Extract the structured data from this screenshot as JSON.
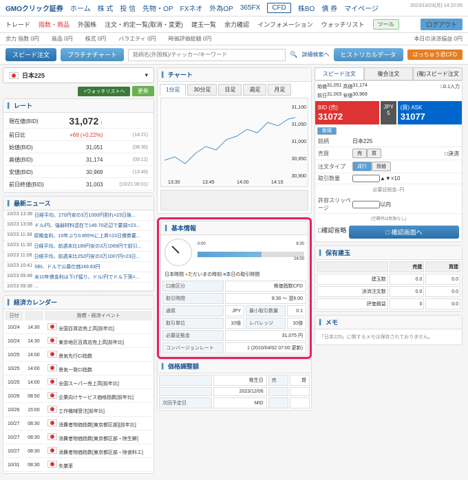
{
  "timestamp": "2023/10/23(月) 14:22:05",
  "topnav": {
    "logo": "GMOクリック証券",
    "items": [
      "ホーム",
      "株 式",
      "投 信",
      "先物・OP",
      "FXネオ",
      "外為OP",
      "365FX",
      "CFD",
      "株BO",
      "債 券",
      "マイページ"
    ],
    "active": "CFD"
  },
  "subnav": {
    "items": [
      "トレード",
      "指数・商品",
      "外国株",
      "注文・約定一覧(取消・変更)",
      "建玉一覧",
      "余力確認",
      "インフォメーション",
      "ウォッチリスト"
    ],
    "tool": "ツール",
    "logout": "ログアウト"
  },
  "status": {
    "items": [
      {
        "l": "余力 指数",
        "v": "0円"
      },
      {
        "l": "商品",
        "v": "0円"
      },
      {
        "l": "株式",
        "v": "0円"
      },
      {
        "l": "バラエティ",
        "v": "0円"
      },
      {
        "l": "時価評価総額",
        "v": "0円"
      },
      {
        "l": "本日の決済損益",
        "v": "0円"
      }
    ]
  },
  "toolbar": {
    "speed": "スピード注文",
    "platinum": "プラチナチャート",
    "placeholder": "銘柄名(外国株)/ティッカー/キーワード",
    "detail": "詳細検索へ",
    "hist": "ヒストリカルデータ",
    "hatchu": "はっちゅう君CFD"
  },
  "symbol": {
    "name": "日本225",
    "watchlist": "+ウォッチリストへ",
    "update": "更新"
  },
  "rate_panel": {
    "title": "レート",
    "rows": [
      {
        "l": "現在値(BID)",
        "v": "31,072",
        "t": "",
        "cls": "big-price",
        "arrow": "↑"
      },
      {
        "l": "前日比",
        "v": "+69 (+0.22%)",
        "t": "(14:21)",
        "red": true
      },
      {
        "l": "始値(BID)",
        "v": "31,051",
        "t": "(08:30)"
      },
      {
        "l": "高値(BID)",
        "v": "31,174",
        "t": "(09:12)"
      },
      {
        "l": "安値(BID)",
        "v": "30,969",
        "t": "(13:40)"
      },
      {
        "l": "前日終値(BID)",
        "v": "31,003",
        "t": "(10/21 06:01)"
      }
    ]
  },
  "news": {
    "title": "最新ニュース",
    "items": [
      {
        "d": "10/23 13:38",
        "t": "日経平均、270円安の3万1000円割れ=23日後..."
      },
      {
        "d": "10/23 13:08",
        "t": "ドル/円、強弱材料混在で149.70近辺で要調=23..."
      },
      {
        "d": "10/23 11:38",
        "t": "原期金利、10年ぶり0.855%に上昇=23日債券要..."
      },
      {
        "d": "10/23 11:30",
        "t": "日経平均、前週末比189円安の3万1069円で前引..."
      },
      {
        "d": "10/23 11:08",
        "t": "日経平均、前週末比252円安の3万1007円=23日..."
      },
      {
        "d": "10/23 10:41",
        "t": "SBI、ドルで公募仕価149.83円"
      },
      {
        "d": "10/23 09:48",
        "t": "米10年債金利は下げ幅り、ドル/円でドル下落=..."
      },
      {
        "d": "10/23 09:38",
        "t": "..."
      }
    ]
  },
  "calendar": {
    "title": "経済カレンダー",
    "h1": "日付",
    "h2": "指標・経済イベント",
    "rows": [
      {
        "d": "10/24",
        "t": "14:30",
        "e": "全国百貨店売上高[前年比]"
      },
      {
        "d": "10/24",
        "t": "14:30",
        "e": "東京地区百貨店売上高[前年比]"
      },
      {
        "d": "10/25",
        "t": "14:00",
        "e": "景気先行CI指数"
      },
      {
        "d": "10/25",
        "t": "14:00",
        "e": "景気一致CI指数"
      },
      {
        "d": "10/25",
        "t": "14:00",
        "e": "全国スーパー売上高[前年比]"
      },
      {
        "d": "10/26",
        "t": "08:50",
        "e": "企業向けサービス価格指数[前年比]"
      },
      {
        "d": "10/26",
        "t": "15:00",
        "e": "工作機械受注[前年比]"
      },
      {
        "d": "10/27",
        "t": "08:30",
        "e": "消費者物価指数[東京都区部][前年比]"
      },
      {
        "d": "10/27",
        "t": "08:30",
        "e": "消費者物価指数[東京都区部・除生鮮]"
      },
      {
        "d": "10/27",
        "t": "08:30",
        "e": "消費者物価指数[東京都区部・除食料エ]"
      },
      {
        "d": "10/31",
        "t": "08:30",
        "e": "失業率"
      }
    ]
  },
  "chart": {
    "title": "チャート",
    "tabs": [
      "1分足",
      "30分足",
      "日足",
      "週足",
      "月足"
    ],
    "active": "1分足",
    "times": [
      "13:30",
      "13:45",
      "14:00",
      "14:15"
    ],
    "prices": [
      "31,100",
      "31,050",
      "31,000",
      "30,950",
      "30,900"
    ]
  },
  "basic_info": {
    "title": "基本情報",
    "time_label": "日本時間",
    "now_lbl": "ただいまの時刻",
    "trade_lbl": "本日の取引時間",
    "times": [
      "0:00",
      "8:30",
      "24:00"
    ],
    "rows": [
      {
        "l": "口座区分",
        "v": "株価指数CFD"
      },
      {
        "l": "取引時間",
        "v": "8:30 ～ 翌6:00"
      },
      {
        "l": "通貨",
        "v": "JPY",
        "l2": "最小取引数量",
        "v2": "0.1"
      },
      {
        "l": "取引単位",
        "v": "10倍",
        "l2": "レバレッジ",
        "v2": "10倍"
      },
      {
        "l": "必要証拠金",
        "v": "31,075 円"
      },
      {
        "l": "コンバージョンレート",
        "v": "1 (2010/04/02 07:00 更新)"
      }
    ]
  },
  "price_adjust": {
    "title": "価格調整額",
    "h1": "発生日",
    "h2": "売",
    "h3": "買",
    "rows": [
      {
        "d": "2023/12/06"
      }
    ],
    "prev_label": "次回予定日",
    "prev_val": "MID"
  },
  "right_tabs": {
    "tab1": "スピード注文",
    "tab2": "複合注文",
    "tab3": "(複)スピード注文",
    "active": 0
  },
  "price_info": {
    "h": "始値",
    "hv": "31,051",
    "hi": "高値",
    "hiv": "31,174",
    "lo": "前日",
    "lov": "31,003",
    "an": "安値",
    "anv": "30,969",
    "zero": "□0.1入力"
  },
  "price_box": {
    "bid_l": "BID (売)",
    "bid": "31072",
    "ask_l": "(買) ASK",
    "ask": "31077",
    "spread": "JPY 5"
  },
  "order_form": {
    "new": "新規",
    "symbol_l": "銘柄",
    "symbol": "日本225",
    "side_l": "売買",
    "sell": "売",
    "buy": "買",
    "clear": "□決済",
    "type_l": "注文タイプ",
    "type1": "成行",
    "type2": "指値",
    "qty_l": "取引数量",
    "qty_unit": "×10",
    "req_margin": "必要証拠金 ̶ 円",
    "slip_l": "許容スリッページ",
    "slip_unit": "以内",
    "slip_note": "(空欄時は制限なし)",
    "confirm_l": "□確認省略",
    "confirm_btn": "□ 確認画面へ"
  },
  "positions": {
    "title": "保有建玉",
    "h1": "売建",
    "h2": "買建",
    "rows": [
      {
        "l": "建玉数",
        "s": "0.0",
        "b": "0.0"
      },
      {
        "l": "決済注文数",
        "s": "0.0",
        "b": "0.0"
      },
      {
        "l": "評価損益",
        "s": "0",
        "b": "0.0"
      }
    ]
  },
  "memo": {
    "title": "メモ",
    "text": "「日本225」に関するメモは保存されておりません。"
  }
}
